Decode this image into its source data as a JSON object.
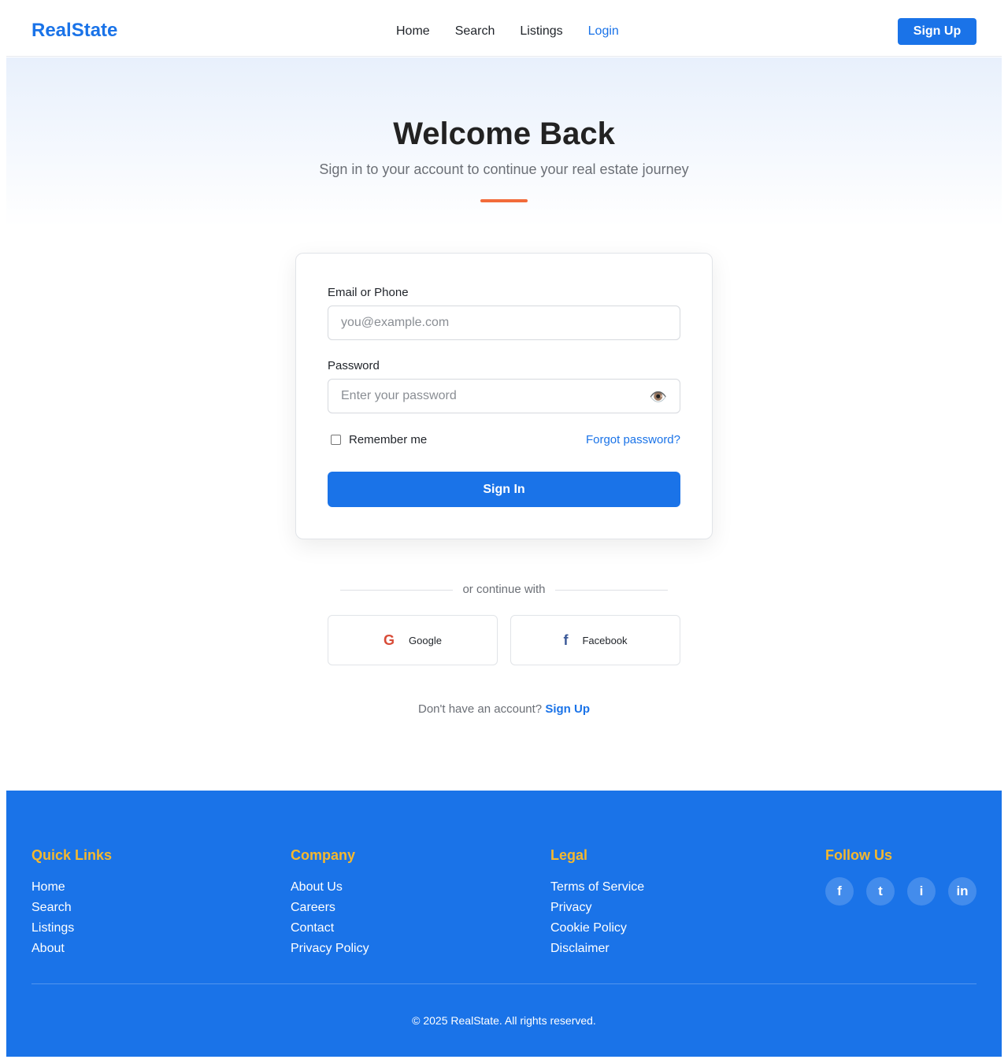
{
  "header": {
    "logo": "RealState",
    "nav": [
      "Home",
      "Search",
      "Listings",
      "Login"
    ],
    "signup_label": "Sign Up"
  },
  "hero": {
    "title": "Welcome Back",
    "subtitle": "Sign in to your account to continue your real estate journey"
  },
  "form": {
    "email_label": "Email or Phone",
    "email_placeholder": "you@example.com",
    "password_label": "Password",
    "password_placeholder": "Enter your password",
    "remember_label": "Remember me",
    "forgot_label": "Forgot password?",
    "signin_label": "Sign In"
  },
  "social": {
    "divider_text": "or continue with",
    "google_label": "Google",
    "google_icon": "G",
    "facebook_label": "Facebook",
    "facebook_icon": "f"
  },
  "signup_prompt": {
    "text": "Don't have an account?",
    "link": "Sign Up"
  },
  "footer": {
    "quick_links": {
      "title": "Quick Links",
      "items": [
        "Home",
        "Search",
        "Listings",
        "About"
      ]
    },
    "company": {
      "title": "Company",
      "items": [
        "About Us",
        "Careers",
        "Contact",
        "Privacy Policy"
      ]
    },
    "legal": {
      "title": "Legal",
      "items": [
        "Terms of Service",
        "Privacy",
        "Cookie Policy",
        "Disclaimer"
      ]
    },
    "follow": {
      "title": "Follow Us",
      "icons": [
        "f",
        "t",
        "i",
        "in"
      ]
    },
    "copyright": "© 2025 RealState. All rights reserved."
  },
  "colors": {
    "primary": "#1a73e8",
    "accent_orange": "#f26b3a",
    "footer_heading": "#f5b82e"
  }
}
